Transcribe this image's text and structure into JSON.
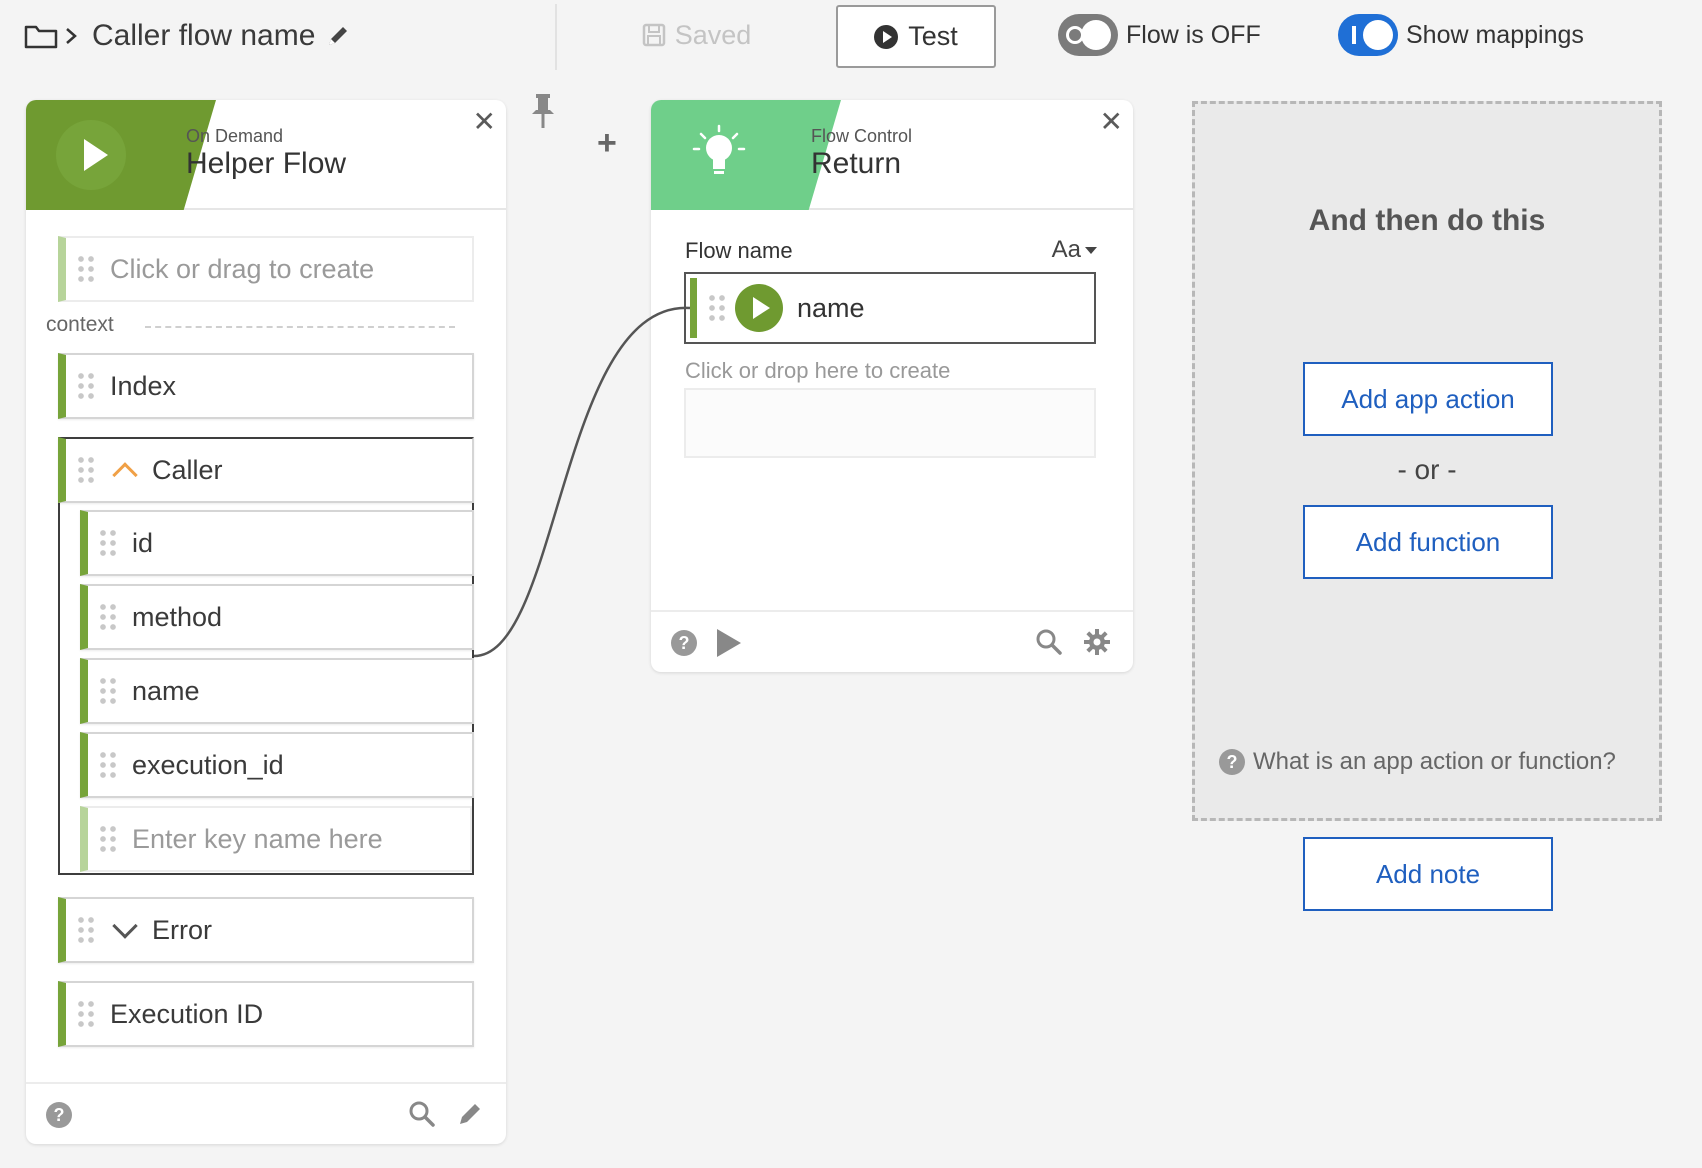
{
  "header": {
    "flow_name": "Caller flow name",
    "saved_label": "Saved",
    "test_label": "Test",
    "flow_toggle_label": "Flow is OFF",
    "mappings_toggle_label": "Show mappings"
  },
  "trigger_card": {
    "subtitle": "On Demand",
    "title": "Helper Flow",
    "create_placeholder": "Click or drag to create",
    "context_label": "context",
    "items": {
      "index": "Index",
      "caller": "Caller",
      "caller_children": [
        "id",
        "method",
        "name",
        "execution_id"
      ],
      "key_placeholder": "Enter key name here",
      "error": "Error",
      "execution_id": "Execution ID"
    }
  },
  "return_card": {
    "subtitle": "Flow Control",
    "title": "Return",
    "field_label": "Flow name",
    "type_label": "Aa",
    "mapped_value": "name",
    "drop_label": "Click or drop here to create"
  },
  "next_step": {
    "title": "And then do this",
    "add_app_action": "Add app action",
    "or_label": "- or -",
    "add_function": "Add function",
    "help_label": "What is an app action or function?",
    "add_note": "Add note"
  },
  "colors": {
    "trigger_green": "#6f9a30",
    "control_green": "#6fcf8a",
    "accent_blue": "#1f5fbf",
    "row_accent": "#77a43a"
  },
  "icons": [
    "folder-icon",
    "chevron-right-icon",
    "pencil-icon",
    "save-icon",
    "play-icon",
    "pin-icon",
    "plus-icon",
    "close-icon",
    "lightbulb-icon",
    "help-icon",
    "search-icon",
    "gear-icon"
  ]
}
